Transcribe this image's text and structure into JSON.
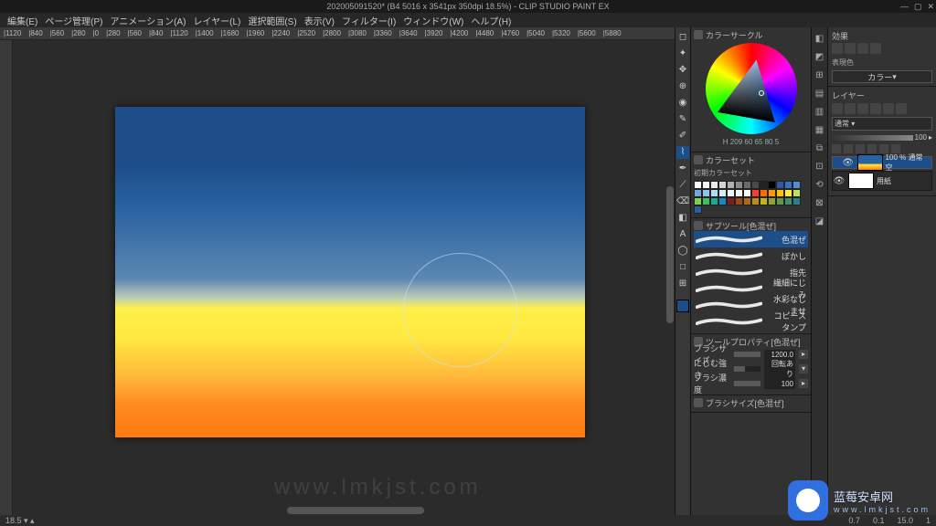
{
  "titlebar": {
    "document": "202005091520* (B4 5016 x 3541px 350dpi 18.5%) - CLIP STUDIO PAINT EX",
    "min": "—",
    "max": "▢",
    "close": "✕"
  },
  "menu": {
    "items": [
      "編集(E)",
      "ページ管理(P)",
      "アニメーション(A)",
      "レイヤー(L)",
      "選択範囲(S)",
      "表示(V)",
      "フィルター(I)",
      "ウィンドウ(W)",
      "ヘルプ(H)"
    ]
  },
  "ruler_h": [
    "|1120",
    "|840",
    "|560",
    "|280",
    "|0",
    "|280",
    "|560",
    "|840",
    "|1120",
    "|1400",
    "|1680",
    "|1960",
    "|2240",
    "|2520",
    "|2800",
    "|3080",
    "|3360",
    "|3640",
    "|3920",
    "|4200",
    "|4480",
    "|4760",
    "|5040",
    "|5320",
    "|5600",
    "|5880"
  ],
  "tools": {
    "items": [
      "◻",
      "✦",
      "✥",
      "⊕",
      "◉",
      "✎",
      "✐",
      "⌇",
      "✒",
      "⟋",
      "⌫",
      "◧",
      "A",
      "◯",
      "□",
      "⊞"
    ],
    "selected_index": 7
  },
  "panels": {
    "color_wheel": {
      "title": "カラーサークル",
      "readout": "H 209 60  65 80   5"
    },
    "color_set": {
      "title": "カラーセット",
      "subtitle": "初期カラーセット",
      "rows": [
        [
          "#ffffff",
          "#f5f5f5",
          "#eaeaea",
          "#d4d4d4",
          "#b0b0b0",
          "#8a8a8a",
          "#6a6a6a",
          "#4a4a4a",
          "#222222",
          "#000000"
        ],
        [
          "#2e59a6",
          "#3673c2",
          "#4f8fd3",
          "#6da8de",
          "#8fc2ea",
          "#b5daf3",
          "#d7ecf9",
          "#eef6fc",
          "#f7fbfe",
          "#ffffff"
        ],
        [
          "#ff3b30",
          "#ff6a00",
          "#ff9800",
          "#ffc107",
          "#ffeb3b",
          "#c0e060",
          "#7fcf4f",
          "#3fbf5f",
          "#1fa890",
          "#1887c2"
        ],
        [
          "#7a1f1f",
          "#9a4a1a",
          "#a96d1a",
          "#b78f1a",
          "#c2b11a",
          "#8fa33a",
          "#5f9650",
          "#3f8f6a",
          "#2f7f88",
          "#2c5f9a"
        ]
      ]
    },
    "subtool": {
      "title": "サブツール[色混ぜ]",
      "items": [
        {
          "label": "色混ぜ",
          "selected": true
        },
        {
          "label": "ぼかし"
        },
        {
          "label": "指先"
        },
        {
          "label": "繊細にじみ"
        },
        {
          "label": "水彩なじませ"
        },
        {
          "label": "コピースタンプ"
        }
      ]
    },
    "tool_property": {
      "title": "ツールプロパティ[色混ぜ]",
      "rows": [
        {
          "label": "ブラシサイズ",
          "value": "1200.0",
          "fill": 100,
          "arrow": "▸"
        },
        {
          "label": "にじむ強さ",
          "value": "回転あり",
          "fill": 40,
          "arrow": "▾"
        },
        {
          "label": "ブラシ濃度",
          "value": "100",
          "fill": 100,
          "arrow": "▸"
        }
      ]
    },
    "brush_size": {
      "title": "ブラシサイズ[色混ぜ]"
    }
  },
  "iconcol": {
    "items": [
      "◧",
      "◩",
      "⊞",
      "▤",
      "▥",
      "▦",
      "⧉",
      "⊡",
      "⟲",
      "⊠",
      "◪"
    ]
  },
  "right": {
    "fx": {
      "title": "効果",
      "sub": "表現色",
      "mode": "カラー"
    },
    "layers": {
      "title": "レイヤー",
      "blend_mode": "通常",
      "opacity": "100",
      "items": [
        {
          "name": "100 % 通常",
          "sub": "空",
          "thumb": "sky",
          "selected": true
        },
        {
          "name": "用紙",
          "thumb": "white"
        }
      ]
    }
  },
  "statusbar": {
    "zoom": "18.5 ▾ ▴",
    "bs_indices": [
      "0.7",
      "0.1",
      "15.0",
      "1"
    ]
  },
  "watermark": {
    "center": "www.lmkjst.com",
    "brand_cn": "蓝莓安卓网",
    "brand_url": "www.lmkjst.com"
  }
}
